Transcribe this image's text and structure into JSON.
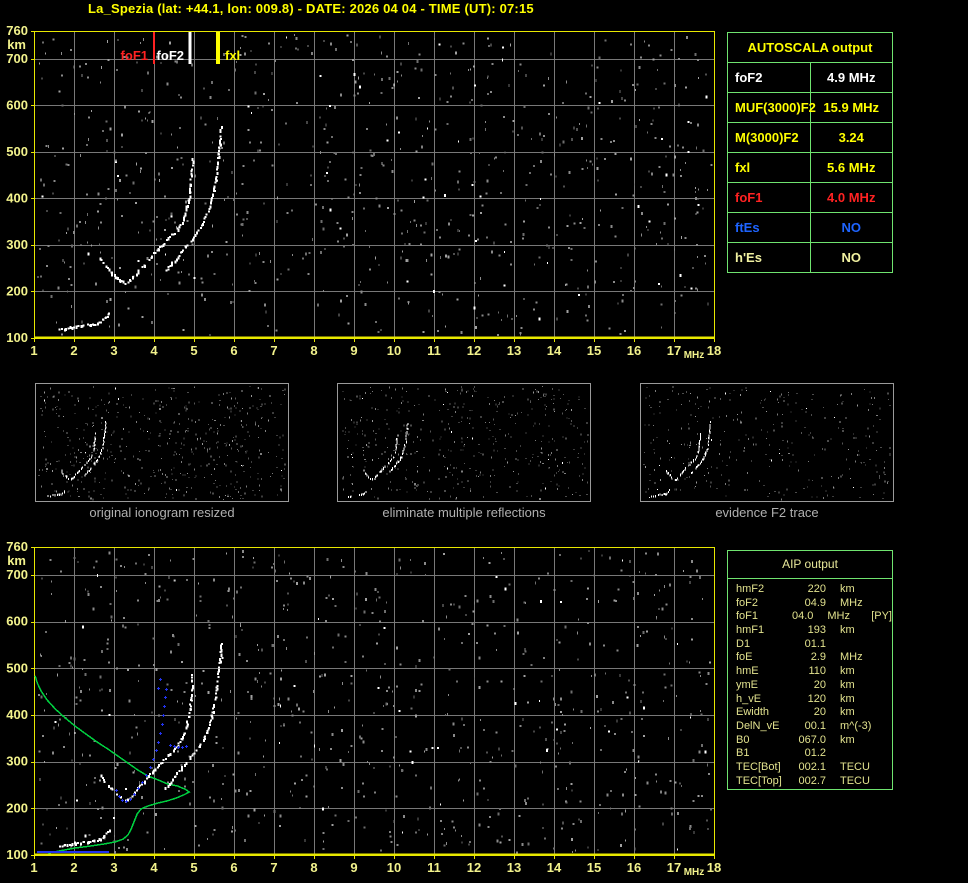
{
  "title": "La_Spezia (lat: +44.1, lon: 009.8) - DATE: 2026 04 04 - TIME (UT): 07:15",
  "colors": {
    "background": "#000000",
    "title": "#ffff00",
    "axis_label": "#f2f28c",
    "plot_border": "#e8e800",
    "grid": "#787878",
    "trace_white": "#ffffff",
    "green_profile": "#00d040",
    "blue_points": "#2233ee",
    "table_border": "#6fe46f",
    "caption_gray": "#b0b0b0",
    "aip_text": "#e2e28e"
  },
  "autoscala_table": {
    "title": "AUTOSCALA output",
    "rows": [
      {
        "label": "foF2",
        "value": "4.9 MHz",
        "color": "#ffffff"
      },
      {
        "label": "MUF(3000)F2",
        "value": "15.9 MHz",
        "color": "#ffff00"
      },
      {
        "label": "M(3000)F2",
        "value": "3.24",
        "color": "#ffff00"
      },
      {
        "label": "fxl",
        "value": "5.6 MHz",
        "color": "#ffff00"
      },
      {
        "label": "foF1",
        "value": "4.0 MHz",
        "color": "#ff2222"
      },
      {
        "label": "ftEs",
        "value": "NO",
        "color": "#1e64ff"
      },
      {
        "label": "h'Es",
        "value": "NO",
        "color": "#f0f0a0"
      }
    ]
  },
  "aip_table": {
    "title": "AIP output",
    "rows": [
      {
        "label": "hmF2",
        "value": "220",
        "unit": "km",
        "extra": ""
      },
      {
        "label": "foF2",
        "value": "04.9",
        "unit": "MHz",
        "extra": ""
      },
      {
        "label": "foF1",
        "value": "04.0",
        "unit": "MHz",
        "extra": "[PY]"
      },
      {
        "label": "hmF1",
        "value": "193",
        "unit": "km",
        "extra": ""
      },
      {
        "label": "D1",
        "value": "01.1",
        "unit": "",
        "extra": ""
      },
      {
        "label": "foE",
        "value": "2.9",
        "unit": "MHz",
        "extra": ""
      },
      {
        "label": "hmE",
        "value": "110",
        "unit": "km",
        "extra": ""
      },
      {
        "label": "ymE",
        "value": "20",
        "unit": "km",
        "extra": ""
      },
      {
        "label": "h_vE",
        "value": "120",
        "unit": "km",
        "extra": ""
      },
      {
        "label": "Ewidth",
        "value": "20",
        "unit": "km",
        "extra": ""
      },
      {
        "label": "DelN_vE",
        "value": "00.1",
        "unit": "m^(-3)",
        "extra": ""
      },
      {
        "label": "B0",
        "value": "067.0",
        "unit": "km",
        "extra": ""
      },
      {
        "label": "B1",
        "value": "01.2",
        "unit": "",
        "extra": ""
      },
      {
        "label": "TEC[Bot]",
        "value": "002.1",
        "unit": "TECU",
        "extra": ""
      },
      {
        "label": "TEC[Top]",
        "value": "002.7",
        "unit": "TECU",
        "extra": ""
      }
    ]
  },
  "thumbnails": [
    {
      "caption": "original ionogram resized"
    },
    {
      "caption": "eliminate multiple reflections"
    },
    {
      "caption": "evidence F2 trace"
    }
  ],
  "chart_data": {
    "type": "scatter",
    "plots": [
      {
        "id": "top",
        "xlabel": "MHz",
        "ylabel": "km",
        "xlim": [
          1,
          18
        ],
        "ylim": [
          100,
          760
        ],
        "xticks": [
          1,
          2,
          3,
          4,
          5,
          6,
          7,
          8,
          9,
          10,
          11,
          12,
          13,
          14,
          15,
          16,
          17,
          18
        ],
        "yticks": [
          760,
          700,
          600,
          500,
          400,
          300,
          200,
          100
        ],
        "grid": true,
        "noise_seed": 7,
        "frequency_markers": [
          {
            "label": "foF1",
            "mhz": 4.0,
            "color": "#ff2222",
            "label_side": "left",
            "line_w": 2
          },
          {
            "label": "foF2",
            "mhz": 4.9,
            "color": "#ffffff",
            "label_side": "left",
            "line_w": 3
          },
          {
            "label": "fxl",
            "mhz": 5.6,
            "color": "#ffff00",
            "label_side": "right",
            "line_w": 4
          }
        ],
        "traces": [
          "e_layer",
          "f_ordinary",
          "f_extraordinary"
        ]
      },
      {
        "id": "bottom",
        "xlabel": "MHz",
        "ylabel": "km",
        "xlim": [
          1,
          18
        ],
        "ylim": [
          100,
          760
        ],
        "xticks": [
          1,
          2,
          3,
          4,
          5,
          6,
          7,
          8,
          9,
          10,
          11,
          12,
          13,
          14,
          15,
          16,
          17,
          18
        ],
        "yticks": [
          760,
          700,
          600,
          500,
          400,
          300,
          200,
          100
        ],
        "grid": true,
        "noise_seed": 13,
        "frequency_markers": [],
        "traces": [
          "e_layer",
          "f_ordinary",
          "f_extraordinary"
        ],
        "profile": "electron_density_profile",
        "blue": "scaled_trace_points"
      }
    ],
    "series": {
      "e_layer": [
        [
          1.62,
          121
        ],
        [
          1.75,
          122
        ],
        [
          1.9,
          124
        ],
        [
          2.05,
          126
        ],
        [
          2.2,
          128
        ],
        [
          2.35,
          130
        ],
        [
          2.5,
          132
        ],
        [
          2.62,
          135
        ],
        [
          2.72,
          140
        ],
        [
          2.8,
          147
        ],
        [
          2.86,
          156
        ]
      ],
      "f_ordinary": [
        [
          2.65,
          272
        ],
        [
          2.78,
          255
        ],
        [
          2.9,
          244
        ],
        [
          3.03,
          233
        ],
        [
          3.15,
          225
        ],
        [
          3.28,
          220
        ],
        [
          3.4,
          225
        ],
        [
          3.5,
          235
        ],
        [
          3.6,
          246
        ],
        [
          3.73,
          257
        ],
        [
          3.85,
          270
        ],
        [
          3.98,
          283
        ],
        [
          4.1,
          293
        ],
        [
          4.23,
          304
        ],
        [
          4.35,
          315
        ],
        [
          4.48,
          326
        ],
        [
          4.58,
          336
        ],
        [
          4.68,
          349
        ],
        [
          4.75,
          364
        ],
        [
          4.8,
          379
        ],
        [
          4.85,
          397
        ],
        [
          4.88,
          414
        ],
        [
          4.9,
          433
        ],
        [
          4.93,
          455
        ],
        [
          4.95,
          487
        ]
      ],
      "f_extraordinary": [
        [
          4.28,
          246
        ],
        [
          4.4,
          259
        ],
        [
          4.53,
          272
        ],
        [
          4.65,
          285
        ],
        [
          4.78,
          298
        ],
        [
          4.9,
          311
        ],
        [
          5.03,
          324
        ],
        [
          5.13,
          336
        ],
        [
          5.23,
          352
        ],
        [
          5.3,
          367
        ],
        [
          5.38,
          384
        ],
        [
          5.43,
          401
        ],
        [
          5.48,
          420
        ],
        [
          5.53,
          440
        ],
        [
          5.55,
          459
        ],
        [
          5.58,
          478
        ],
        [
          5.6,
          498
        ],
        [
          5.63,
          517
        ],
        [
          5.65,
          536
        ],
        [
          5.65,
          556
        ]
      ],
      "electron_density_profile": [
        [
          1.35,
          104
        ],
        [
          1.65,
          109
        ],
        [
          2.03,
          115
        ],
        [
          2.4,
          119
        ],
        [
          2.78,
          124
        ],
        [
          3.03,
          128
        ],
        [
          3.23,
          134
        ],
        [
          3.35,
          143
        ],
        [
          3.43,
          156
        ],
        [
          3.5,
          171
        ],
        [
          3.58,
          188
        ],
        [
          3.68,
          199
        ],
        [
          3.85,
          205
        ],
        [
          4.08,
          211
        ],
        [
          4.33,
          216
        ],
        [
          4.55,
          222
        ],
        [
          4.75,
          229
        ],
        [
          4.88,
          235
        ],
        [
          4.78,
          241
        ],
        [
          4.58,
          248
        ],
        [
          4.35,
          252
        ],
        [
          4.1,
          261
        ],
        [
          3.85,
          269
        ],
        [
          3.6,
          282
        ],
        [
          3.35,
          297
        ],
        [
          3.1,
          312
        ],
        [
          2.85,
          327
        ],
        [
          2.58,
          342
        ],
        [
          2.3,
          359
        ],
        [
          2.03,
          376
        ],
        [
          1.75,
          396
        ],
        [
          1.53,
          413
        ],
        [
          1.33,
          432
        ],
        [
          1.18,
          451
        ],
        [
          1.08,
          469
        ],
        [
          1.03,
          484
        ]
      ],
      "scaled_trace_points": {
        "es_row": {
          "mhz_from": 1.1,
          "mhz_to": 2.85,
          "step": 0.05,
          "km": 106
        },
        "f_points": [
          [
            3.05,
            239
          ],
          [
            3.13,
            226
          ],
          [
            3.2,
            218
          ],
          [
            3.3,
            216
          ],
          [
            3.4,
            220
          ],
          [
            3.5,
            231
          ],
          [
            3.6,
            244
          ],
          [
            3.7,
            256
          ],
          [
            3.8,
            271
          ],
          [
            3.9,
            289
          ],
          [
            3.98,
            306
          ],
          [
            4.05,
            325
          ],
          [
            4.1,
            342
          ],
          [
            4.15,
            361
          ],
          [
            4.2,
            381
          ],
          [
            4.23,
            400
          ],
          [
            4.25,
            419
          ],
          [
            4.28,
            439
          ],
          [
            4.3,
            456
          ],
          [
            4.4,
            336
          ],
          [
            4.5,
            334
          ],
          [
            4.6,
            331
          ],
          [
            4.7,
            331
          ],
          [
            4.8,
            334
          ],
          [
            4.1,
            458
          ],
          [
            4.15,
            477
          ]
        ]
      }
    }
  }
}
